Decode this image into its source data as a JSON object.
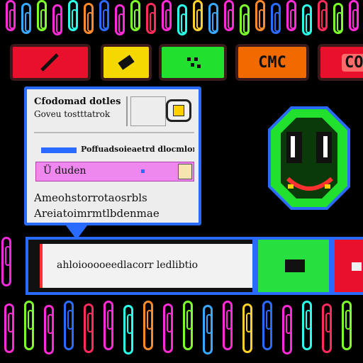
{
  "toolbar": {
    "buttons": [
      {
        "id": "red",
        "icon": "slash-icon",
        "color": "#e8102a"
      },
      {
        "id": "yellow",
        "icon": "tag-icon",
        "color": "#f5d800"
      },
      {
        "id": "green",
        "icon": "dots-icon",
        "color": "#21e12e"
      },
      {
        "id": "orange",
        "label": "CMC",
        "color": "#f06a00"
      },
      {
        "id": "red-right",
        "label": "CO",
        "color": "#e8102a"
      }
    ]
  },
  "dialog": {
    "header_text": "Cfodomad dotles",
    "subheader_text": "Goveu tostttatrok",
    "link_text": "Poffuadsoieaetrd dlocmlors",
    "input_value": "Ü duden",
    "line1": "Ameohstorrotaosrbls",
    "line2": "Areiatoimrmtlbdenmae"
  },
  "bottom_bar": {
    "text": "ahloiooooeedlacorr ledlibtio",
    "green_color": "#27e040",
    "red_color": "#e8102a"
  },
  "colors": {
    "accent_blue": "#2a6bff",
    "magenta": "#ee2bd8",
    "green": "#21e12e",
    "background": "#000000"
  }
}
